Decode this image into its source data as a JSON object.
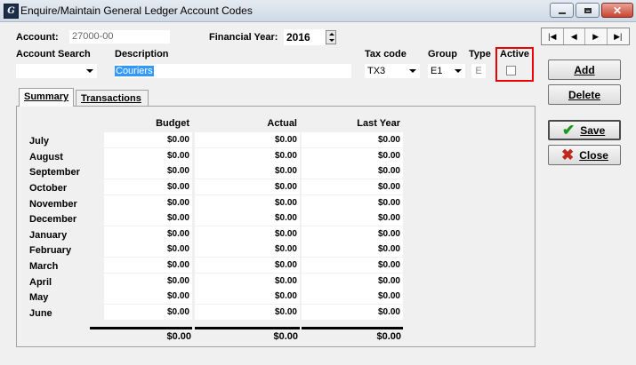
{
  "window": {
    "title": "Enquire/Maintain General Ledger Account Codes",
    "app_icon": "app-logo-icon"
  },
  "header": {
    "account_label": "Account:",
    "account_value": "27000-00",
    "financial_year_label": "Financial Year:",
    "financial_year_value": "2016"
  },
  "fields": {
    "account_search_label": "Account Search",
    "account_search_value": "",
    "description_label": "Description",
    "description_value": "Couriers",
    "tax_code_label": "Tax code",
    "tax_code_value": "TX3",
    "group_label": "Group",
    "group_value": "E1",
    "type_label": "Type",
    "type_value": "E",
    "active_label": "Active",
    "active_checked": false
  },
  "buttons": {
    "add": "Add",
    "delete": "Delete",
    "save": "Save",
    "close": "Close"
  },
  "tabs": [
    {
      "label": "Summary",
      "active": true
    },
    {
      "label": "Transactions",
      "active": false
    }
  ],
  "summary": {
    "columns": [
      "Budget",
      "Actual",
      "Last Year"
    ],
    "rows": [
      {
        "month": "July",
        "budget": "$0.00",
        "actual": "$0.00",
        "last_year": "$0.00"
      },
      {
        "month": "August",
        "budget": "$0.00",
        "actual": "$0.00",
        "last_year": "$0.00"
      },
      {
        "month": "September",
        "budget": "$0.00",
        "actual": "$0.00",
        "last_year": "$0.00"
      },
      {
        "month": "October",
        "budget": "$0.00",
        "actual": "$0.00",
        "last_year": "$0.00"
      },
      {
        "month": "November",
        "budget": "$0.00",
        "actual": "$0.00",
        "last_year": "$0.00"
      },
      {
        "month": "December",
        "budget": "$0.00",
        "actual": "$0.00",
        "last_year": "$0.00"
      },
      {
        "month": "January",
        "budget": "$0.00",
        "actual": "$0.00",
        "last_year": "$0.00"
      },
      {
        "month": "February",
        "budget": "$0.00",
        "actual": "$0.00",
        "last_year": "$0.00"
      },
      {
        "month": "March",
        "budget": "$0.00",
        "actual": "$0.00",
        "last_year": "$0.00"
      },
      {
        "month": "April",
        "budget": "$0.00",
        "actual": "$0.00",
        "last_year": "$0.00"
      },
      {
        "month": "May",
        "budget": "$0.00",
        "actual": "$0.00",
        "last_year": "$0.00"
      },
      {
        "month": "June",
        "budget": "$0.00",
        "actual": "$0.00",
        "last_year": "$0.00"
      }
    ],
    "totals": {
      "budget": "$0.00",
      "actual": "$0.00",
      "last_year": "$0.00"
    }
  },
  "colors": {
    "highlight_box": "#e00000",
    "save_check": "#1a9a1a",
    "close_x": "#c0281c",
    "selection": "#3399ff"
  }
}
